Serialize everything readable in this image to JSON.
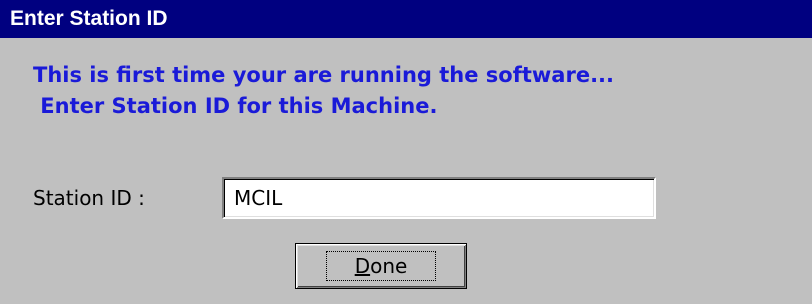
{
  "window": {
    "title": "Enter Station ID"
  },
  "message": {
    "line1": "This is first time your are running the software...",
    "line2": " Enter Station ID for this Machine."
  },
  "form": {
    "station_label": "Station ID :",
    "station_value": "MCIL"
  },
  "done_button": {
    "mnemonic": "D",
    "rest": "one"
  },
  "colors": {
    "title_bar": "#000080",
    "message_text": "#1a1ad8",
    "background": "#c0c0c0"
  }
}
